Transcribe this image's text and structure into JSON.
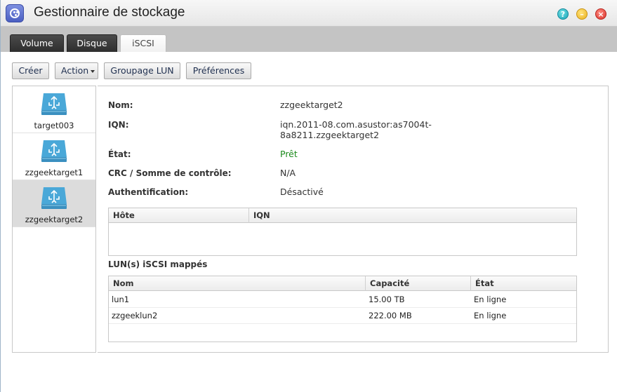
{
  "window": {
    "title": "Gestionnaire de stockage"
  },
  "window_buttons": {
    "help": "?",
    "minimize": "–",
    "close": "×"
  },
  "tabs": [
    {
      "label": "Volume",
      "active": false
    },
    {
      "label": "Disque",
      "active": false
    },
    {
      "label": "iSCSI",
      "active": true
    }
  ],
  "toolbar": {
    "create_label": "Créer",
    "action_label": "Action",
    "lun_group_label": "Groupage LUN",
    "preferences_label": "Préférences"
  },
  "targets": [
    {
      "label": "target003",
      "icon": "iscsi-disk-icon",
      "selected": false
    },
    {
      "label": "zzgeektarget1",
      "icon": "iscsi-disk-icon",
      "selected": false
    },
    {
      "label": "zzgeektarget2",
      "icon": "iscsi-disk-icon",
      "selected": true
    }
  ],
  "details": {
    "name_label": "Nom:",
    "name_value": "zzgeektarget2",
    "iqn_label": "IQN:",
    "iqn_value_line1": "iqn.2011-08.com.asustor:as7004t-",
    "iqn_value_line2": "8a8211.zzgeektarget2",
    "state_label": "État:",
    "state_value": "Prêt",
    "crc_label": "CRC / Somme de contrôle:",
    "crc_value": "N/A",
    "auth_label": "Authentification:",
    "auth_value": "Désactivé"
  },
  "hosts_table": {
    "headers": [
      "Hôte",
      "IQN"
    ],
    "rows": []
  },
  "luns_section_title": "LUN(s) iSCSI mappés",
  "luns_table": {
    "headers": [
      "Nom",
      "Capacité",
      "État"
    ],
    "rows": [
      [
        "lun1",
        "15.00 TB",
        "En ligne"
      ],
      [
        "zzgeeklun2",
        "222.00 MB",
        "En ligne"
      ]
    ]
  },
  "colors": {
    "accent_icon": "#4aa8d8",
    "status_ok": "#1b8a1b",
    "tab_dark": "#3a3a3a"
  }
}
